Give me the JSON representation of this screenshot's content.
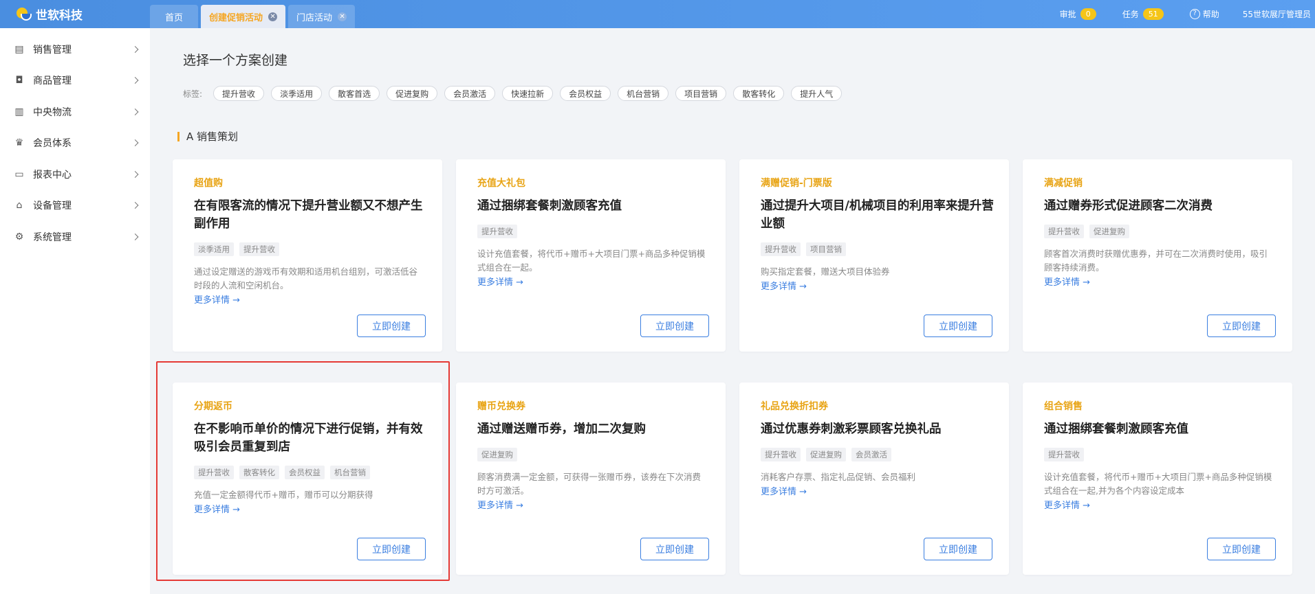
{
  "app": {
    "logo_text": "世软科技",
    "tabs": [
      {
        "label": "首页"
      },
      {
        "label": "创建促销活动"
      },
      {
        "label": "门店活动"
      }
    ],
    "approve_label": "审批",
    "approve_count": "0",
    "task_label": "任务",
    "task_count": "51",
    "help_label": "帮助",
    "user_label": "55世软展厅管理员"
  },
  "sidebar": {
    "items": [
      {
        "label": "销售管理",
        "icon": "calendar-icon"
      },
      {
        "label": "商品管理",
        "icon": "bag-icon"
      },
      {
        "label": "中央物流",
        "icon": "logistics-icon"
      },
      {
        "label": "会员体系",
        "icon": "crown-icon"
      },
      {
        "label": "报表中心",
        "icon": "report-icon"
      },
      {
        "label": "设备管理",
        "icon": "device-icon"
      },
      {
        "label": "系统管理",
        "icon": "settings-icon"
      }
    ]
  },
  "main": {
    "title": "选择一个方案创建",
    "tags_label": "标签:",
    "tags": [
      "提升营收",
      "淡季适用",
      "散客首选",
      "促进复购",
      "会员激活",
      "快速拉新",
      "会员权益",
      "机台营销",
      "项目营销",
      "散客转化",
      "提升人气"
    ],
    "section_title": "A 销售策划",
    "more_label": "更多详情 →",
    "button_label": "立即创建",
    "cards": [
      {
        "category": "超值购",
        "title": "在有限客流的情况下提升营业额又不想产生副作用",
        "tags": [
          "淡季适用",
          "提升营收"
        ],
        "desc": "通过设定赠送的游戏币有效期和适用机台组别，可激活低谷时段的人流和空闲机台。"
      },
      {
        "category": "充值大礼包",
        "title": "通过捆绑套餐刺激顾客充值",
        "tags": [
          "提升营收"
        ],
        "desc": "设计充值套餐，将代币+赠币+大项目门票+商品多种促销模式组合在一起。"
      },
      {
        "category": "满赠促销-门票版",
        "title": "通过提升大项目/机械项目的利用率来提升营业额",
        "tags": [
          "提升营收",
          "项目营销"
        ],
        "desc": "购买指定套餐，赠送大项目体验券"
      },
      {
        "category": "满减促销",
        "title": "通过赠券形式促进顾客二次消费",
        "tags": [
          "提升营收",
          "促进复购"
        ],
        "desc": "顾客首次消费时获赠优惠券，并可在二次消费时使用，吸引顾客持续消费。"
      },
      {
        "category": "分期返币",
        "title": "在不影响币单价的情况下进行促销，并有效吸引会员重复到店",
        "tags": [
          "提升营收",
          "散客转化",
          "会员权益",
          "机台营销"
        ],
        "desc": "充值一定金额得代币+赠币，赠币可以分期获得"
      },
      {
        "category": "赠币兑换券",
        "title": "通过赠送赠币券，增加二次复购",
        "tags": [
          "促进复购"
        ],
        "desc": "顾客消费满一定金额，可获得一张赠币券，该券在下次消费时方可激活。"
      },
      {
        "category": "礼品兑换折扣券",
        "title": "通过优惠券刺激彩票顾客兑换礼品",
        "tags": [
          "提升营收",
          "促进复购",
          "会员激活"
        ],
        "desc": "消耗客户存票、指定礼品促销、会员福利"
      },
      {
        "category": "组合销售",
        "title": "通过捆绑套餐刺激顾客充值",
        "tags": [
          "提升营收"
        ],
        "desc": "设计充值套餐，将代币+赠币+大项目门票+商品多种促销模式组合在一起,并为各个内容设定成本"
      }
    ]
  },
  "colors": {
    "topbar": "#4a90e2",
    "accent": "#f5a623",
    "link": "#3a7ee0",
    "highlight": "#e53935"
  }
}
